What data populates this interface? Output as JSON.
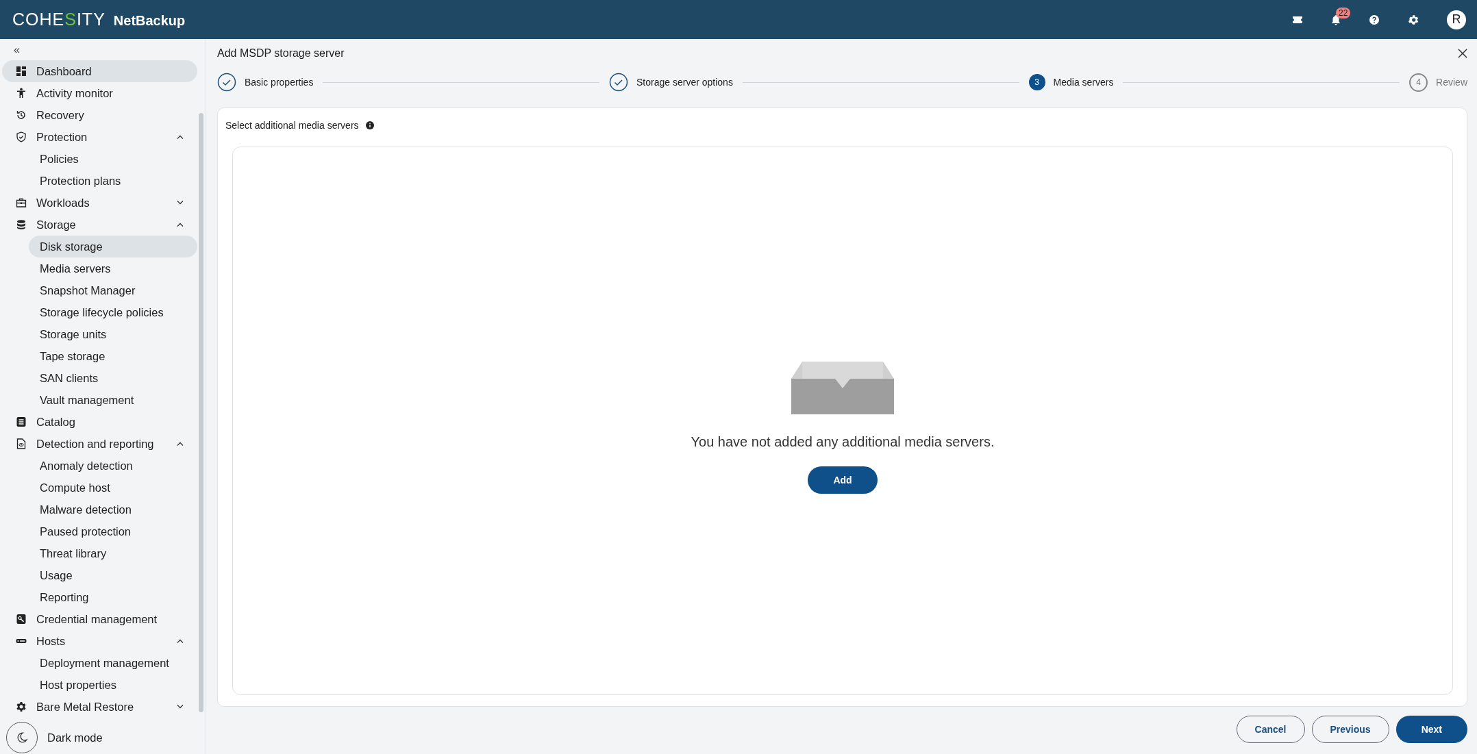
{
  "header": {
    "logo": [
      {
        "text": "COHE",
        "accent": false
      },
      {
        "text": "S",
        "accent": true
      },
      {
        "text": "ITY",
        "accent": false
      }
    ],
    "product": "NetBackup",
    "notifications": "22",
    "avatar": "R"
  },
  "sidebar": {
    "collapse": "«",
    "items": [
      {
        "label": "Dashboard",
        "selected": true
      },
      {
        "label": "Activity monitor",
        "selected": false
      },
      {
        "label": "Recovery",
        "selected": false
      },
      {
        "label": "Protection",
        "selected": false,
        "expanded": true,
        "children": [
          {
            "label": "Policies",
            "selected": false
          },
          {
            "label": "Protection plans",
            "selected": false
          }
        ]
      },
      {
        "label": "Workloads",
        "selected": false,
        "expanded": false
      },
      {
        "label": "Storage",
        "selected": false,
        "expanded": true,
        "children": [
          {
            "label": "Disk storage",
            "selected": true
          },
          {
            "label": "Media servers",
            "selected": false
          },
          {
            "label": "Snapshot Manager",
            "selected": false
          },
          {
            "label": "Storage lifecycle policies",
            "selected": false
          },
          {
            "label": "Storage units",
            "selected": false
          },
          {
            "label": "Tape storage",
            "selected": false
          },
          {
            "label": "SAN clients",
            "selected": false
          },
          {
            "label": "Vault management",
            "selected": false
          }
        ]
      },
      {
        "label": "Catalog",
        "selected": false
      },
      {
        "label": "Detection and reporting",
        "selected": false,
        "expanded": true,
        "children": [
          {
            "label": "Anomaly detection",
            "selected": false
          },
          {
            "label": "Compute host",
            "selected": false
          },
          {
            "label": "Malware detection",
            "selected": false
          },
          {
            "label": "Paused protection",
            "selected": false
          },
          {
            "label": "Threat library",
            "selected": false
          },
          {
            "label": "Usage",
            "selected": false
          },
          {
            "label": "Reporting",
            "selected": false
          }
        ]
      },
      {
        "label": "Credential management",
        "selected": false
      },
      {
        "label": "Hosts",
        "selected": false,
        "expanded": true,
        "children": [
          {
            "label": "Deployment management",
            "selected": false
          },
          {
            "label": "Host properties",
            "selected": false
          }
        ]
      },
      {
        "label": "Bare Metal Restore",
        "selected": false,
        "expanded": false
      }
    ],
    "dark_mode": "Dark mode"
  },
  "dialog": {
    "title": "Add MSDP storage server",
    "steps": [
      {
        "label": "Basic properties",
        "kind": "done"
      },
      {
        "label": "Storage server options",
        "kind": "done"
      },
      {
        "label": "Media servers",
        "number": "3",
        "kind": "current"
      },
      {
        "label": "Review",
        "number": "4",
        "kind": "pending"
      }
    ],
    "section_label": "Select additional media servers",
    "empty_message": "You have not added any additional media servers.",
    "add_button": "Add",
    "buttons": [
      {
        "label": "Cancel",
        "kind": "outline"
      },
      {
        "label": "Previous",
        "kind": "outline"
      },
      {
        "label": "Next",
        "kind": "primary"
      }
    ]
  }
}
